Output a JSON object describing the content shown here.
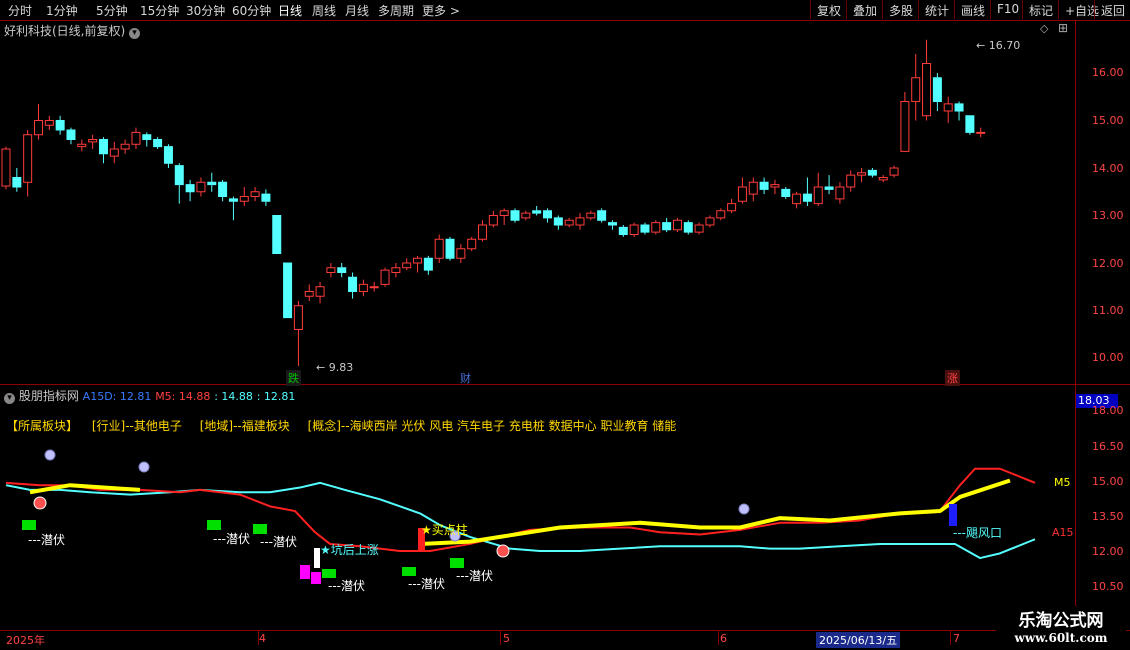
{
  "toolbar": {
    "periods": [
      "分时",
      "1分钟",
      "5分钟",
      "15分钟",
      "30分钟",
      "60分钟",
      "日线",
      "周线",
      "月线",
      "多周期",
      "更多 >"
    ],
    "active": "日线",
    "right_buttons": [
      "复权",
      "叠加",
      "多股",
      "统计",
      "画线",
      "F10",
      "标记",
      "+自选",
      "返回"
    ]
  },
  "main_chart": {
    "title": "好利科技(日线,前复权)",
    "y_labels": [
      "16.00",
      "15.00",
      "14.00",
      "13.00",
      "12.00",
      "11.00",
      "10.00"
    ],
    "high_label": "16.70",
    "low_label": "9.83",
    "badges": [
      {
        "text": "跌",
        "color": "#00c000"
      },
      {
        "text": "财",
        "color": "#4a6fd8"
      },
      {
        "text": "涨",
        "color": "#e03030"
      }
    ],
    "candles": [
      {
        "o": 13.62,
        "c": 14.4,
        "h": 14.45,
        "l": 13.55
      },
      {
        "o": 13.8,
        "c": 13.6,
        "h": 14.0,
        "l": 13.5
      },
      {
        "o": 13.7,
        "c": 14.7,
        "h": 14.8,
        "l": 13.4
      },
      {
        "o": 14.7,
        "c": 15.0,
        "h": 15.35,
        "l": 14.6
      },
      {
        "o": 14.9,
        "c": 15.0,
        "h": 15.1,
        "l": 14.8
      },
      {
        "o": 15.0,
        "c": 14.8,
        "h": 15.1,
        "l": 14.7
      },
      {
        "o": 14.8,
        "c": 14.6,
        "h": 14.85,
        "l": 14.5
      },
      {
        "o": 14.45,
        "c": 14.5,
        "h": 14.6,
        "l": 14.35
      },
      {
        "o": 14.55,
        "c": 14.6,
        "h": 14.7,
        "l": 14.4
      },
      {
        "o": 14.6,
        "c": 14.3,
        "h": 14.65,
        "l": 14.1
      },
      {
        "o": 14.25,
        "c": 14.4,
        "h": 14.55,
        "l": 14.1
      },
      {
        "o": 14.4,
        "c": 14.5,
        "h": 14.6,
        "l": 14.3
      },
      {
        "o": 14.5,
        "c": 14.75,
        "h": 14.85,
        "l": 14.4
      },
      {
        "o": 14.7,
        "c": 14.6,
        "h": 14.75,
        "l": 14.45
      },
      {
        "o": 14.6,
        "c": 14.45,
        "h": 14.65,
        "l": 14.4
      },
      {
        "o": 14.45,
        "c": 14.1,
        "h": 14.5,
        "l": 14.0
      },
      {
        "o": 14.05,
        "c": 13.65,
        "h": 14.1,
        "l": 13.25
      },
      {
        "o": 13.65,
        "c": 13.5,
        "h": 13.75,
        "l": 13.3
      },
      {
        "o": 13.5,
        "c": 13.7,
        "h": 13.8,
        "l": 13.4
      },
      {
        "o": 13.7,
        "c": 13.65,
        "h": 13.9,
        "l": 13.5
      },
      {
        "o": 13.7,
        "c": 13.4,
        "h": 13.75,
        "l": 13.3
      },
      {
        "o": 13.35,
        "c": 13.3,
        "h": 13.4,
        "l": 12.9
      },
      {
        "o": 13.3,
        "c": 13.4,
        "h": 13.6,
        "l": 13.2
      },
      {
        "o": 13.4,
        "c": 13.5,
        "h": 13.6,
        "l": 13.3
      },
      {
        "o": 13.45,
        "c": 13.3,
        "h": 13.55,
        "l": 13.2
      },
      {
        "o": 13.0,
        "c": 12.2,
        "h": 13.0,
        "l": 12.2
      },
      {
        "o": 12.0,
        "c": 10.85,
        "h": 12.0,
        "l": 10.85
      },
      {
        "o": 10.6,
        "c": 11.1,
        "h": 11.2,
        "l": 9.83
      },
      {
        "o": 11.3,
        "c": 11.4,
        "h": 11.55,
        "l": 11.2
      },
      {
        "o": 11.3,
        "c": 11.5,
        "h": 11.6,
        "l": 11.15
      },
      {
        "o": 11.8,
        "c": 11.9,
        "h": 12.0,
        "l": 11.7
      },
      {
        "o": 11.9,
        "c": 11.8,
        "h": 12.0,
        "l": 11.7
      },
      {
        "o": 11.7,
        "c": 11.4,
        "h": 11.8,
        "l": 11.25
      },
      {
        "o": 11.4,
        "c": 11.55,
        "h": 11.65,
        "l": 11.3
      },
      {
        "o": 11.5,
        "c": 11.5,
        "h": 11.6,
        "l": 11.4
      },
      {
        "o": 11.55,
        "c": 11.85,
        "h": 11.9,
        "l": 11.5
      },
      {
        "o": 11.8,
        "c": 11.9,
        "h": 12.0,
        "l": 11.7
      },
      {
        "o": 11.9,
        "c": 12.0,
        "h": 12.1,
        "l": 11.85
      },
      {
        "o": 12.0,
        "c": 12.1,
        "h": 12.15,
        "l": 11.8
      },
      {
        "o": 12.1,
        "c": 11.85,
        "h": 12.15,
        "l": 11.75
      },
      {
        "o": 12.1,
        "c": 12.5,
        "h": 12.6,
        "l": 12.0
      },
      {
        "o": 12.5,
        "c": 12.1,
        "h": 12.55,
        "l": 12.05
      },
      {
        "o": 12.1,
        "c": 12.3,
        "h": 12.4,
        "l": 12.0
      },
      {
        "o": 12.3,
        "c": 12.5,
        "h": 12.55,
        "l": 12.25
      },
      {
        "o": 12.5,
        "c": 12.8,
        "h": 12.9,
        "l": 12.45
      },
      {
        "o": 12.8,
        "c": 13.0,
        "h": 13.1,
        "l": 12.75
      },
      {
        "o": 13.0,
        "c": 13.1,
        "h": 13.15,
        "l": 12.8
      },
      {
        "o": 13.1,
        "c": 12.9,
        "h": 13.15,
        "l": 12.85
      },
      {
        "o": 12.95,
        "c": 13.05,
        "h": 13.1,
        "l": 12.9
      },
      {
        "o": 13.1,
        "c": 13.05,
        "h": 13.2,
        "l": 13.0
      },
      {
        "o": 13.1,
        "c": 12.95,
        "h": 13.15,
        "l": 12.85
      },
      {
        "o": 12.95,
        "c": 12.8,
        "h": 13.0,
        "l": 12.7
      },
      {
        "o": 12.8,
        "c": 12.9,
        "h": 12.95,
        "l": 12.75
      },
      {
        "o": 12.8,
        "c": 12.95,
        "h": 13.05,
        "l": 12.7
      },
      {
        "o": 12.95,
        "c": 13.05,
        "h": 13.1,
        "l": 12.9
      },
      {
        "o": 13.1,
        "c": 12.9,
        "h": 13.15,
        "l": 12.85
      },
      {
        "o": 12.85,
        "c": 12.8,
        "h": 12.9,
        "l": 12.7
      },
      {
        "o": 12.75,
        "c": 12.6,
        "h": 12.8,
        "l": 12.55
      },
      {
        "o": 12.6,
        "c": 12.8,
        "h": 12.85,
        "l": 12.55
      },
      {
        "o": 12.8,
        "c": 12.65,
        "h": 12.85,
        "l": 12.6
      },
      {
        "o": 12.65,
        "c": 12.85,
        "h": 12.9,
        "l": 12.6
      },
      {
        "o": 12.85,
        "c": 12.7,
        "h": 12.95,
        "l": 12.65
      },
      {
        "o": 12.7,
        "c": 12.9,
        "h": 12.95,
        "l": 12.65
      },
      {
        "o": 12.85,
        "c": 12.65,
        "h": 12.9,
        "l": 12.6
      },
      {
        "o": 12.65,
        "c": 12.8,
        "h": 12.85,
        "l": 12.6
      },
      {
        "o": 12.8,
        "c": 12.95,
        "h": 13.0,
        "l": 12.75
      },
      {
        "o": 12.95,
        "c": 13.1,
        "h": 13.15,
        "l": 12.9
      },
      {
        "o": 13.1,
        "c": 13.25,
        "h": 13.35,
        "l": 13.05
      },
      {
        "o": 13.3,
        "c": 13.6,
        "h": 13.8,
        "l": 13.25
      },
      {
        "o": 13.45,
        "c": 13.7,
        "h": 13.8,
        "l": 13.3
      },
      {
        "o": 13.7,
        "c": 13.55,
        "h": 13.8,
        "l": 13.45
      },
      {
        "o": 13.6,
        "c": 13.65,
        "h": 13.75,
        "l": 13.45
      },
      {
        "o": 13.55,
        "c": 13.4,
        "h": 13.6,
        "l": 13.35
      },
      {
        "o": 13.25,
        "c": 13.45,
        "h": 13.5,
        "l": 13.15
      },
      {
        "o": 13.45,
        "c": 13.3,
        "h": 13.8,
        "l": 13.2
      },
      {
        "o": 13.25,
        "c": 13.6,
        "h": 13.9,
        "l": 13.2
      },
      {
        "o": 13.6,
        "c": 13.55,
        "h": 13.85,
        "l": 13.45
      },
      {
        "o": 13.35,
        "c": 13.6,
        "h": 13.7,
        "l": 13.25
      },
      {
        "o": 13.6,
        "c": 13.85,
        "h": 13.95,
        "l": 13.5
      },
      {
        "o": 13.85,
        "c": 13.9,
        "h": 14.0,
        "l": 13.7
      },
      {
        "o": 13.95,
        "c": 13.85,
        "h": 14.0,
        "l": 13.8
      },
      {
        "o": 13.75,
        "c": 13.8,
        "h": 13.85,
        "l": 13.7
      },
      {
        "o": 13.85,
        "c": 14.0,
        "h": 14.05,
        "l": 13.8
      },
      {
        "o": 14.35,
        "c": 15.4,
        "h": 15.6,
        "l": 14.35
      },
      {
        "o": 15.4,
        "c": 15.9,
        "h": 16.4,
        "l": 15.0
      },
      {
        "o": 15.1,
        "c": 16.2,
        "h": 16.7,
        "l": 15.0
      },
      {
        "o": 15.9,
        "c": 15.4,
        "h": 16.0,
        "l": 15.2
      },
      {
        "o": 15.2,
        "c": 15.35,
        "h": 15.5,
        "l": 14.95
      },
      {
        "o": 15.35,
        "c": 15.2,
        "h": 15.4,
        "l": 15.0
      },
      {
        "o": 15.1,
        "c": 14.75,
        "h": 15.1,
        "l": 14.7
      },
      {
        "o": 14.75,
        "c": 14.75,
        "h": 14.85,
        "l": 14.65
      }
    ]
  },
  "indicator": {
    "title": "股朋指标网",
    "a15d_label": "A15D: 12.81",
    "m5_label": "M5: 14.88",
    "extra1": ": 14.88",
    "extra2": ": 12.81",
    "readout": "18.03",
    "board_title": "【所属板块】",
    "boards": [
      "[行业]--其他电子",
      "[地域]--福建板块",
      "[概念]--海峡西岸 光伏 风电 汽车电子 充电桩 数据中心 职业教育 储能"
    ],
    "y_labels": [
      "18.00",
      "16.50",
      "15.00",
      "13.50",
      "12.00",
      "10.50"
    ],
    "line_label_m5": "M5",
    "line_label_a15": "A15D",
    "signals": {
      "qianfu": "---潜伏",
      "kenghou": "★坑后上涨",
      "maidian": "★买点柱",
      "feng": "---飓风口"
    }
  },
  "bottom_axis": {
    "labels": [
      "2025年",
      "4",
      "5",
      "6",
      "2025/06/13/五",
      "7"
    ]
  },
  "watermark": {
    "line1": "乐淘公式网",
    "line2": "www.60lt.com"
  },
  "colors": {
    "up": "#ff3c3c",
    "down": "#54ffff",
    "m5": "#ffff00",
    "a15": "#ff2020",
    "border": "#8b0000"
  }
}
